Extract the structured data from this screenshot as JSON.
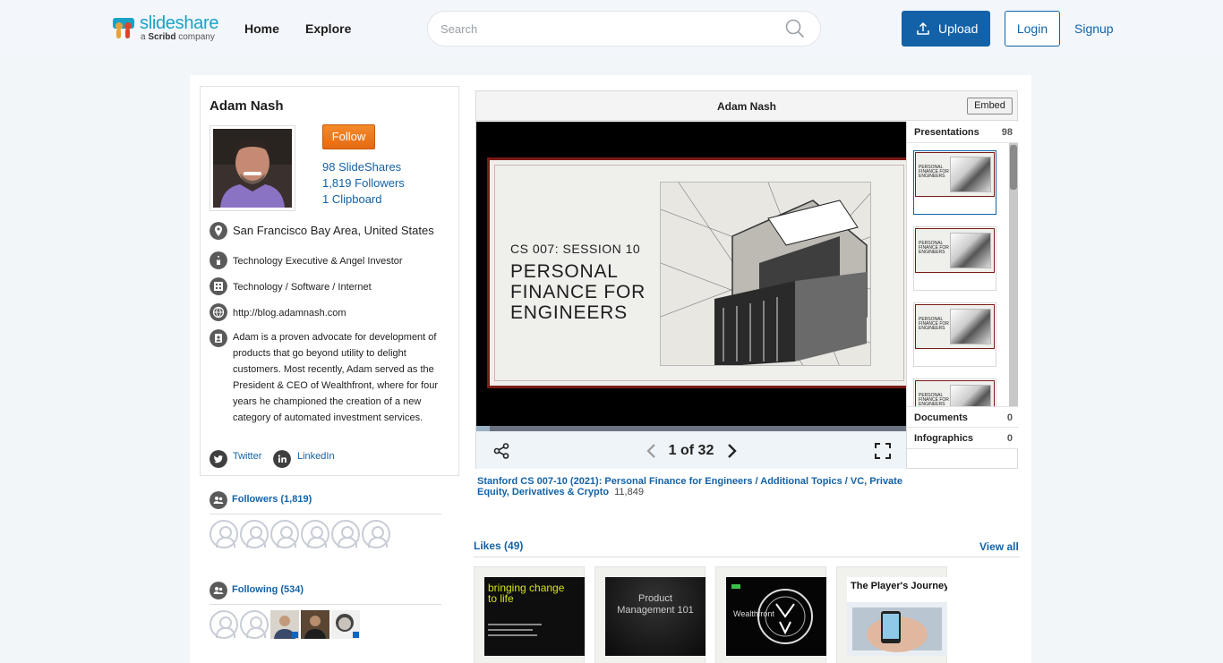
{
  "header": {
    "logo_text": "slideshare",
    "logo_sub_prefix": "a",
    "logo_sub_brand": "Scribd",
    "logo_sub_suffix": "company",
    "nav_home": "Home",
    "nav_explore": "Explore",
    "search_placeholder": "Search",
    "upload_label": "Upload",
    "login_label": "Login",
    "signup_label": "Signup"
  },
  "profile": {
    "name": "Adam Nash",
    "follow_label": "Follow",
    "stats": [
      "98 SlideShares",
      "1,819 Followers",
      "1 Clipboard"
    ],
    "location": "San Francisco Bay Area, United States",
    "occupation": "Technology Executive & Angel Investor",
    "industry": "Technology / Software / Internet",
    "website": "http://blog.adamnash.com",
    "bio": "Adam is a proven advocate for development of products that go beyond utility to delight customers. Most recently, Adam served as the President & CEO of Wealthfront, where for four years he championed the creation of a new category of automated investment services.",
    "twitter": "Twitter",
    "linkedin": "LinkedIn"
  },
  "followers": {
    "title": "Followers (1,819)"
  },
  "following": {
    "title": "Following (534)"
  },
  "viewer": {
    "title": "Adam Nash",
    "embed_label": "Embed",
    "slide_subtitle": "CS 007: SESSION 10",
    "slide_title": "PERSONAL FINANCE FOR ENGINEERS",
    "page_label": "1 of 32",
    "progress": 0.031,
    "tabs": {
      "presentations": {
        "label": "Presentations",
        "count": "98"
      },
      "documents": {
        "label": "Documents",
        "count": "0"
      },
      "infographics": {
        "label": "Infographics",
        "count": "0"
      }
    },
    "thumb_text": "PERSONAL FINANCE FOR ENGINEERS"
  },
  "caption": {
    "title": "Stanford CS 007-10 (2021): Personal Finance for Engineers / Additional Topics / VC, Private Equity, Derivatives & Crypto",
    "views": "11,849"
  },
  "likes": {
    "title": "Likes (49)",
    "view_all": "View all",
    "cards": [
      {
        "text_line1": "bringing change",
        "text_line2": "to life"
      },
      {
        "text_line1": "Product",
        "text_line2": "Management 101"
      },
      {
        "text_line1": "Wealthfront",
        "text_line2": ""
      },
      {
        "text_line1": "The Player's Journey",
        "text_line2": ""
      }
    ]
  },
  "colors": {
    "brand_blue": "#1362a8",
    "follow_orange": "#f07a1e",
    "slide_border": "#7a1b16"
  }
}
